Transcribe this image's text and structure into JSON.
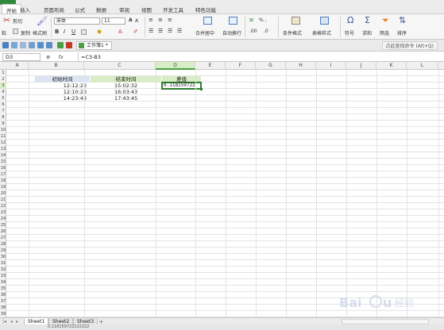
{
  "menubar": {
    "tabs": [
      "开始",
      "插入",
      "页面布局",
      "公式",
      "数据",
      "审阅",
      "视图",
      "开发工具",
      "特色功能"
    ]
  },
  "ribbon": {
    "cut": "剪切",
    "copy": "复制",
    "format_painter": "格式刷",
    "font_name": "宋体",
    "font_size": "11",
    "merge": "合并居中",
    "wrap": "自动换行",
    "cond_format": "条件格式",
    "table_style": "表格样式",
    "symbol": "符号",
    "sum": "求和",
    "filter": "筛选",
    "sort": "排序",
    "number_format": "% ,"
  },
  "qat": {
    "doc_tab": "工作簿1 *",
    "find_command": "点此查找命令 (Alt+Q)"
  },
  "formula_bar": {
    "name_box": "D3",
    "fx": "fx",
    "formula": "=C3-B3"
  },
  "columns": [
    "A",
    "B",
    "C",
    "D",
    "E",
    "F",
    "G",
    "H",
    "I",
    "J",
    "K",
    "L"
  ],
  "rows": [
    "1",
    "2",
    "3",
    "4",
    "5",
    "6",
    "7",
    "8",
    "9",
    "10",
    "11",
    "12",
    "13",
    "14",
    "15",
    "16",
    "17",
    "18",
    "19",
    "20",
    "21",
    "22",
    "23",
    "24",
    "25",
    "26",
    "27",
    "28",
    "29",
    "30",
    "31",
    "32",
    "33",
    "34",
    "35",
    "36",
    "37",
    "38",
    "39"
  ],
  "table": {
    "header_b": "初始时间",
    "header_c": "结束时间",
    "header_d": "差值",
    "b3": "12:12:23",
    "b4": "12:10:23",
    "b5": "14:23:43",
    "c3": "15:02:32",
    "c4": "16:03:43",
    "c5": "17:43:45",
    "d3": "0.118159722"
  },
  "sheets": [
    "Sheet1",
    "Sheet2",
    "Sheet3"
  ],
  "status": {
    "text": "0.118159722222222"
  },
  "watermark": "Baidu 经验",
  "colors": {
    "accent_green": "#4a9e45",
    "header_blue": "#dbe5f1",
    "header_green": "#d8ecc6"
  }
}
